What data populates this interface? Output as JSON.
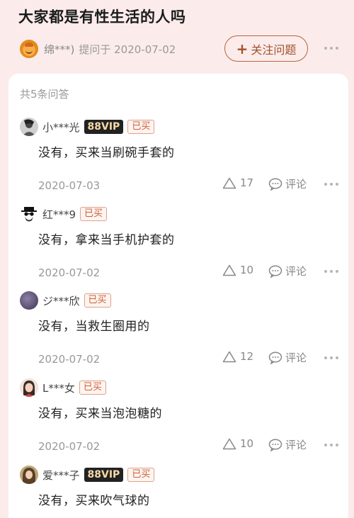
{
  "question": {
    "title": "大家都是有性生活的人吗",
    "asker_name": "绵***)",
    "asked_at": "提问于 2020-07-02",
    "follow_label": "关注问题",
    "follow_icon": "plus-icon"
  },
  "summary": {
    "count_label": "共5条问答"
  },
  "labels": {
    "bought": "已买",
    "vip": "88VIP",
    "comment": "评论"
  },
  "answers": [
    {
      "user": "小***光",
      "vip": true,
      "text": "没有，买来当刷碗手套的",
      "date": "2020-07-03",
      "likes": "17"
    },
    {
      "user": "红***9",
      "vip": false,
      "text": "没有，拿来当手机护套的",
      "date": "2020-07-02",
      "likes": "10"
    },
    {
      "user": "ジ***欣",
      "vip": false,
      "text": "没有，当救生圈用的",
      "date": "2020-07-02",
      "likes": "12"
    },
    {
      "user": "L***女",
      "vip": false,
      "text": "没有，买来当泡泡糖的",
      "date": "2020-07-02",
      "likes": "10"
    },
    {
      "user": "爱***子",
      "vip": true,
      "text": "没有，买来吹气球的",
      "date": "",
      "likes": ""
    }
  ],
  "colors": {
    "page_bg": "#fbeceb",
    "accent": "#a2522c",
    "bought_border": "#e0a28a"
  }
}
